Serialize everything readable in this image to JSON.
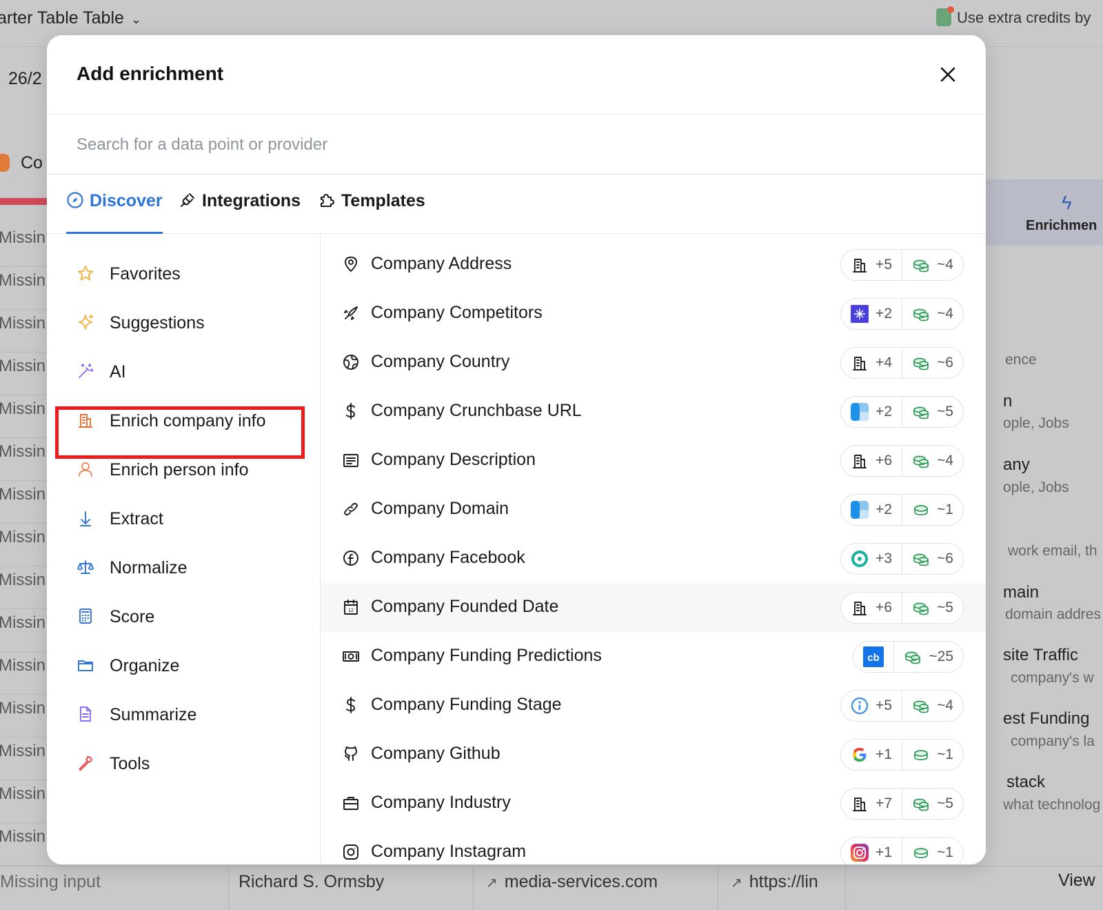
{
  "background": {
    "title": "arter Table Table",
    "credits": "Use extra credits by",
    "count": "26/2",
    "column_header": "Co",
    "missing_rows": [
      "Missin",
      "Missin",
      "Missin",
      "Missin",
      "Missin",
      "Missin",
      "Missin",
      "Missin",
      "Missin",
      "Missin",
      "Missin",
      "Missin",
      "Missin",
      "Missin",
      "Missin"
    ],
    "bottom_row": {
      "cell1": "Missing input",
      "cell2": "Richard S. Ormsby",
      "cell3": "media-services.com",
      "cell4": "https://lin"
    },
    "view_label": "View",
    "side_panel": {
      "enrichment_label": "Enrichmen",
      "snippets": [
        "ence",
        "n",
        "ople, Jobs",
        "any",
        "ople, Jobs",
        "work email, th",
        "main",
        "domain addres",
        "site Traffic",
        "company's w",
        "est Funding",
        "company's la",
        "stack",
        "what technolog"
      ]
    }
  },
  "modal": {
    "title": "Add enrichment",
    "search_placeholder": "Search for a data point or provider",
    "tabs": [
      {
        "label": "Discover",
        "icon": "compass-icon",
        "active": true
      },
      {
        "label": "Integrations",
        "icon": "plug-icon",
        "active": false
      },
      {
        "label": "Templates",
        "icon": "puzzle-icon",
        "active": false
      }
    ],
    "categories": [
      {
        "label": "Favorites",
        "icon": "star-icon",
        "color": "#f5b13d"
      },
      {
        "label": "Suggestions",
        "icon": "sparkle-icon",
        "color": "#f5b13d"
      },
      {
        "label": "AI",
        "icon": "magic-wand-icon",
        "color": "#8b6cf0"
      },
      {
        "label": "Enrich company info",
        "icon": "building-icon",
        "color": "#e5713a",
        "highlighted": true
      },
      {
        "label": "Enrich person info",
        "icon": "person-icon",
        "color": "#f08a5d"
      },
      {
        "label": "Extract",
        "icon": "arrow-down-icon",
        "color": "#2f74d8"
      },
      {
        "label": "Normalize",
        "icon": "scale-icon",
        "color": "#2f74d8"
      },
      {
        "label": "Score",
        "icon": "calculator-icon",
        "color": "#2f74d8"
      },
      {
        "label": "Organize",
        "icon": "folder-icon",
        "color": "#2f74d8"
      },
      {
        "label": "Summarize",
        "icon": "document-icon",
        "color": "#8b6cf0"
      },
      {
        "label": "Tools",
        "icon": "wrench-icon",
        "color": "#e5484d"
      }
    ],
    "enrichments": [
      {
        "name": "Company Address",
        "icon": "map-pin-icon",
        "provider": "building-icon",
        "providers": "+5",
        "credits": "~4"
      },
      {
        "name": "Company Competitors",
        "icon": "rocket-icon",
        "provider": "purple-spark-logo",
        "providers": "+2",
        "credits": "~4"
      },
      {
        "name": "Company Country",
        "icon": "globe-icon",
        "provider": "building-icon",
        "providers": "+4",
        "credits": "~6"
      },
      {
        "name": "Company Crunchbase URL",
        "icon": "dollar-icon",
        "provider": "blue-square-logo",
        "providers": "+2",
        "credits": "~5"
      },
      {
        "name": "Company Description",
        "icon": "text-box-icon",
        "provider": "building-icon",
        "providers": "+6",
        "credits": "~4"
      },
      {
        "name": "Company Domain",
        "icon": "link-icon",
        "provider": "blue-square-logo",
        "providers": "+2",
        "credits": "~1"
      },
      {
        "name": "Company Facebook",
        "icon": "facebook-icon",
        "provider": "teal-ring-logo",
        "providers": "+3",
        "credits": "~6"
      },
      {
        "name": "Company Founded Date",
        "icon": "calendar-icon",
        "provider": "building-icon",
        "providers": "+6",
        "credits": "~5",
        "hover": true
      },
      {
        "name": "Company Funding Predictions",
        "icon": "banknote-icon",
        "provider": "cb-logo",
        "providers": "",
        "credits": "~25"
      },
      {
        "name": "Company Funding Stage",
        "icon": "dollar-icon",
        "provider": "info-ring-logo",
        "providers": "+5",
        "credits": "~4"
      },
      {
        "name": "Company Github",
        "icon": "github-icon",
        "provider": "google-logo",
        "providers": "+1",
        "credits": "~1"
      },
      {
        "name": "Company Industry",
        "icon": "briefcase-icon",
        "provider": "building-icon",
        "providers": "+7",
        "credits": "~5"
      },
      {
        "name": "Company Instagram",
        "icon": "instagram-icon",
        "provider": "instagram-logo",
        "providers": "+1",
        "credits": "~1"
      }
    ]
  }
}
